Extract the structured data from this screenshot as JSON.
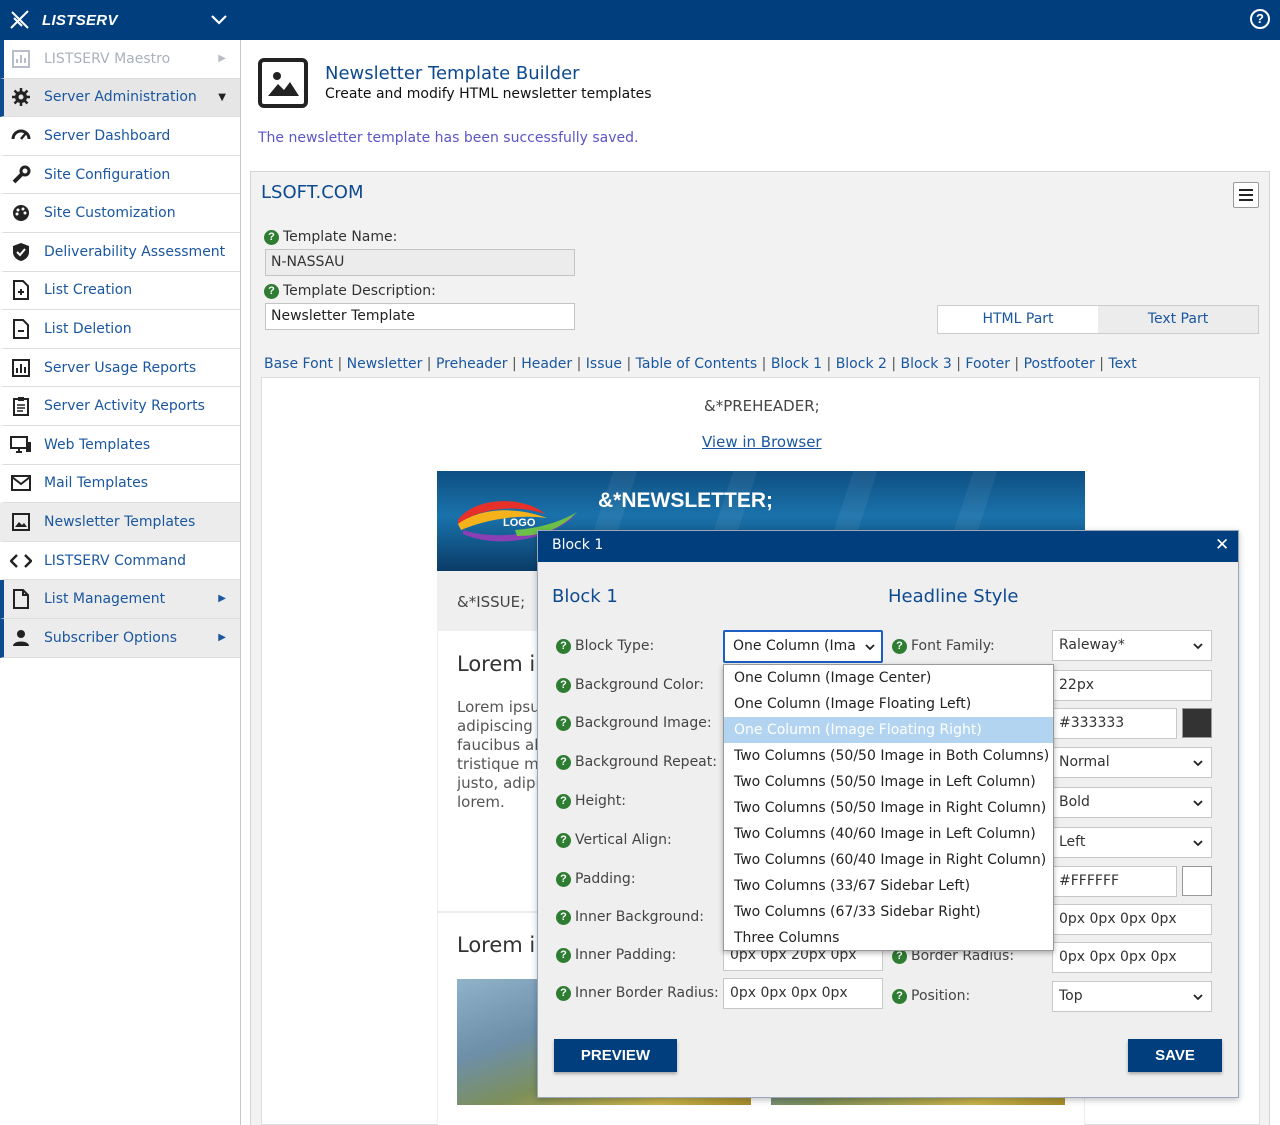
{
  "app": {
    "brand": "LISTSERV"
  },
  "sidebar": {
    "items": [
      {
        "label": "LISTSERV Maestro",
        "icon": "chart-icon"
      },
      {
        "label": "Server Administration",
        "icon": "gear-icon"
      },
      {
        "label": "Server Dashboard",
        "icon": "dashboard-icon"
      },
      {
        "label": "Site Configuration",
        "icon": "wrench-icon"
      },
      {
        "label": "Site Customization",
        "icon": "palette-icon"
      },
      {
        "label": "Deliverability Assessment",
        "icon": "shield-check-icon"
      },
      {
        "label": "List Creation",
        "icon": "file-plus-icon"
      },
      {
        "label": "List Deletion",
        "icon": "file-minus-icon"
      },
      {
        "label": "Server Usage Reports",
        "icon": "bar-chart-icon"
      },
      {
        "label": "Server Activity Reports",
        "icon": "clipboard-icon"
      },
      {
        "label": "Web Templates",
        "icon": "monitor-icon"
      },
      {
        "label": "Mail Templates",
        "icon": "envelope-icon"
      },
      {
        "label": "Newsletter Templates",
        "icon": "image-icon"
      },
      {
        "label": "LISTSERV Command",
        "icon": "code-icon"
      },
      {
        "label": "List Management",
        "icon": "document-icon"
      },
      {
        "label": "Subscriber Options",
        "icon": "person-icon"
      }
    ]
  },
  "page": {
    "title": "Newsletter Template Builder",
    "subtitle": "Create and modify HTML newsletter templates",
    "success": "The newsletter template has been successfully saved."
  },
  "panel": {
    "title": "LSOFT.COM",
    "template_name_label": "Template Name:",
    "template_name_value": "N-NASSAU",
    "template_desc_label": "Template Description:",
    "template_desc_value": "Newsletter Template",
    "tabs": [
      "HTML Part",
      "Text Part"
    ],
    "section_links": [
      "Base Font",
      "Newsletter",
      "Preheader",
      "Header",
      "Issue",
      "Table of Contents",
      "Block 1",
      "Block 2",
      "Block 3",
      "Footer",
      "Postfooter",
      "Text"
    ]
  },
  "preview": {
    "preheader": "&*PREHEADER;",
    "view_in_browser": "View in Browser",
    "logo": "LOGO",
    "newsletter": "&*NEWSLETTER;",
    "issue": "&*ISSUE;",
    "heading1": "Lorem ip",
    "paragraph": [
      "Lorem ipsu",
      "adipiscing",
      "faucibus al",
      "tristique m",
      "justo, adipi",
      "lorem."
    ],
    "heading2": "Lorem ip"
  },
  "modal": {
    "title": "Block 1",
    "left_heading": "Block 1",
    "right_heading": "Headline Style",
    "left_fields": [
      {
        "label": "Block Type:",
        "value": "One Column (Ima"
      },
      {
        "label": "Background Color:",
        "value": ""
      },
      {
        "label": "Background Image:",
        "value": ""
      },
      {
        "label": "Background Repeat:",
        "value": ""
      },
      {
        "label": "Height:",
        "value": ""
      },
      {
        "label": "Vertical Align:",
        "value": ""
      },
      {
        "label": "Padding:",
        "value": ""
      },
      {
        "label": "Inner Background:",
        "value": ""
      },
      {
        "label": "Inner Padding:",
        "value": "0px 0px 20px 0px"
      },
      {
        "label": "Inner Border Radius:",
        "value": "0px 0px 0px 0px"
      }
    ],
    "right_fields": [
      {
        "label": "Font Family:",
        "value": "Raleway*"
      },
      {
        "label": "",
        "value": "22px"
      },
      {
        "label": "",
        "value": "#333333",
        "swatch": "#333333"
      },
      {
        "label": "",
        "value": "Normal"
      },
      {
        "label": "",
        "value": "Bold"
      },
      {
        "label": "",
        "value": "Left"
      },
      {
        "label": "",
        "value": "#FFFFFF",
        "swatch": "#FFFFFF"
      },
      {
        "label": "",
        "value": "0px 0px 0px 0px"
      },
      {
        "label": "Border Radius:",
        "value": "0px 0px 0px 0px"
      },
      {
        "label": "Position:",
        "value": "Top"
      }
    ],
    "block_type_options": [
      "One Column (Image Center)",
      "One Column (Image Floating Left)",
      "One Column (Image Floating Right)",
      "Two Columns (50/50 Image in Both Columns)",
      "Two Columns (50/50 Image in Left Column)",
      "Two Columns (50/50 Image in Right Column)",
      "Two Columns (40/60 Image in Left Column)",
      "Two Columns (60/40 Image in Right Column)",
      "Two Columns (33/67 Sidebar Left)",
      "Two Columns (67/33 Sidebar Right)",
      "Three Columns"
    ],
    "selected_option": "One Column (Image Floating Right)",
    "preview_button": "PREVIEW",
    "save_button": "SAVE"
  },
  "colors": {
    "primary": "#003e7e",
    "link": "#1b57a0",
    "success": "#5b55c7",
    "help": "#2e7d32"
  }
}
